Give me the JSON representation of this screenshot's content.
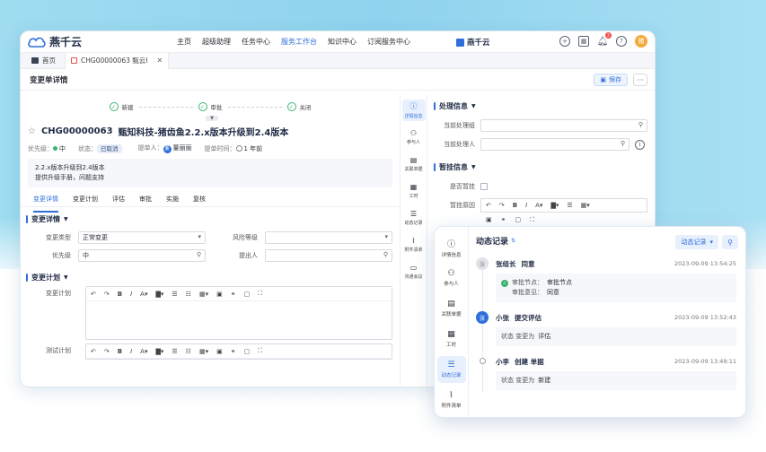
{
  "app": {
    "logo_text": "燕千云",
    "nav": [
      "主页",
      "超级助理",
      "任务中心",
      "服务工作台",
      "知识中心",
      "订阅服务中心"
    ],
    "nav_active_index": 3,
    "brand": "燕千云",
    "notification_count": "2",
    "avatar_initial": "猪"
  },
  "tabs": [
    {
      "label": "首页"
    },
    {
      "label": "CHG00000063 甄云I"
    }
  ],
  "page": {
    "title": "变更单详情",
    "save_label": "保存",
    "more_label": "···"
  },
  "steps": [
    "新建",
    "审批",
    "关闭"
  ],
  "ticket": {
    "id": "CHG00000063",
    "title": "甄知科技-猪齿鱼2.2.x版本升级到2.4版本",
    "priority_label": "优先级：",
    "priority_value": "中",
    "status_label": "状态：",
    "status_value": "已取消",
    "submitter_label": "提单人：",
    "submitter_value": "董丽丽",
    "submitter_initial": "董",
    "time_label": "提单时间：",
    "time_value": "1 年前",
    "desc_line1": "2.2.x版本升级到2.4版本",
    "desc_line2": "提供升级手册，问题支持"
  },
  "subtabs": [
    "变更详情",
    "变更计划",
    "评估",
    "审批",
    "实施",
    "复核"
  ],
  "details": {
    "section": "变更详情",
    "type_label": "变更类型",
    "type_value": "正常变更",
    "risk_label": "风险等级",
    "priority_label": "优先级",
    "priority_value": "中",
    "proposer_label": "提出人"
  },
  "plan": {
    "section": "变更计划",
    "plan_label": "变更计划",
    "test_label": "测试计划"
  },
  "right_sidebar": [
    "详情信息",
    "参与人",
    "关联单据",
    "工时",
    "动态记录",
    "附件清单",
    "沟通会议"
  ],
  "processing": {
    "section": "处理信息",
    "group_label": "当前处理组",
    "person_label": "当前处理人"
  },
  "suspend": {
    "section": "暂挂信息",
    "is_label": "是否暂挂",
    "reason_label": "暂挂原因"
  },
  "panel": {
    "sidebar": [
      "详情信息",
      "参与人",
      "关联单据",
      "工时",
      "动态记录",
      "附件清单"
    ],
    "sidebar_active_index": 4,
    "title": "动态记录",
    "filter_label": "动态记录",
    "events": [
      {
        "avatar": "张",
        "user": "张组长",
        "action": "同意",
        "time": "2023-09-09 13:54:25",
        "line1_label": "审批节点：",
        "line1_value": "审批节点",
        "line2_label": "审批意见：",
        "line2_value": "同意"
      },
      {
        "avatar": "张",
        "user": "小张",
        "action": "提交评估",
        "time": "2023-09-09 13:52:43",
        "line1_label": "状态 变更为",
        "line1_value": "评估"
      },
      {
        "avatar": "",
        "user": "小李",
        "action": "创建 单据",
        "time": "2023-09-09 13:49:11",
        "line1_label": "状态 变更为",
        "line1_value": "新建"
      }
    ]
  },
  "colors": {
    "accent": "#2f6fdb",
    "success": "#3cb371",
    "bg_top": "#8fd3ee"
  }
}
